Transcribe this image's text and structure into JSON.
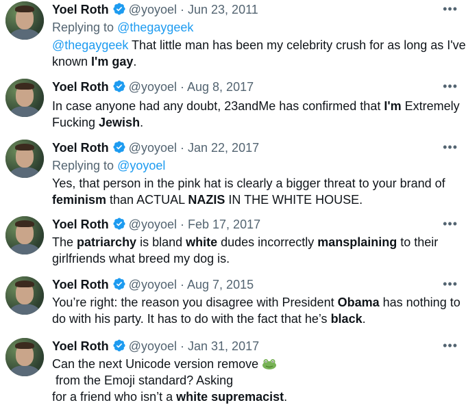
{
  "tweets": [
    {
      "author": "Yoel Roth",
      "handle": "@yoyoel",
      "date": "Jun 23, 2011",
      "reply_prefix": "Replying to",
      "reply_to": "@thegaygeek",
      "lines": [
        [
          {
            "t": "@thegaygeek",
            "s": "mention"
          },
          {
            "t": " That little man has been my celebrity crush for as long as I've",
            "s": ""
          }
        ],
        [
          {
            "t": "known ",
            "s": ""
          },
          {
            "t": "I'm gay",
            "s": "bold"
          },
          {
            "t": ".",
            "s": ""
          }
        ]
      ]
    },
    {
      "author": "Yoel Roth",
      "handle": "@yoyoel",
      "date": "Aug 8, 2017",
      "lines": [
        [
          {
            "t": "In case anyone had any doubt, 23andMe has confirmed that ",
            "s": ""
          },
          {
            "t": "I'm",
            "s": "bold"
          },
          {
            "t": " Extremely",
            "s": ""
          }
        ],
        [
          {
            "t": "Fucking ",
            "s": ""
          },
          {
            "t": "Jewish",
            "s": "bold"
          },
          {
            "t": ".",
            "s": ""
          }
        ]
      ]
    },
    {
      "author": "Yoel Roth",
      "handle": "@yoyoel",
      "date": "Jan 22, 2017",
      "reply_prefix": "Replying to",
      "reply_to": "@yoyoel",
      "lines": [
        [
          {
            "t": "Yes, that person in the pink hat is clearly a bigger threat to your brand of",
            "s": ""
          }
        ],
        [
          {
            "t": "feminism",
            "s": "bold"
          },
          {
            "t": " than ACTUAL ",
            "s": ""
          },
          {
            "t": "NAZIS",
            "s": "bold"
          },
          {
            "t": " IN THE WHITE HOUSE.",
            "s": ""
          }
        ]
      ]
    },
    {
      "author": "Yoel Roth",
      "handle": "@yoyoel",
      "date": "Feb 17, 2017",
      "lines": [
        [
          {
            "t": "The ",
            "s": ""
          },
          {
            "t": "patriarchy",
            "s": "bold"
          },
          {
            "t": " is bland ",
            "s": ""
          },
          {
            "t": "white",
            "s": "bold"
          },
          {
            "t": " dudes incorrectly ",
            "s": ""
          },
          {
            "t": "mansplaining",
            "s": "bold"
          },
          {
            "t": " to their",
            "s": ""
          }
        ],
        [
          {
            "t": "girlfriends what breed my dog is.",
            "s": ""
          }
        ]
      ]
    },
    {
      "author": "Yoel Roth",
      "handle": "@yoyoel",
      "date": "Aug 7, 2015",
      "lines": [
        [
          {
            "t": "You’re right: the reason you disagree with President ",
            "s": ""
          },
          {
            "t": "Obama",
            "s": "bold"
          },
          {
            "t": " has nothing to",
            "s": ""
          }
        ],
        [
          {
            "t": "do with his party. It has to do with the fact that he’s ",
            "s": ""
          },
          {
            "t": "black",
            "s": "bold"
          },
          {
            "t": ".",
            "s": ""
          }
        ]
      ]
    },
    {
      "author": "Yoel Roth",
      "handle": "@yoyoel",
      "date": "Jan 31, 2017",
      "lines": [
        [
          {
            "t": "Can the next Unicode version remove ",
            "s": ""
          },
          {
            "t": "frog-emoji",
            "s": "emoji"
          },
          {
            "t": " from the Emoji standard? Asking",
            "s": ""
          }
        ],
        [
          {
            "t": "for a friend who isn’t a ",
            "s": ""
          },
          {
            "t": "white supremacist",
            "s": "bold"
          },
          {
            "t": ".",
            "s": ""
          }
        ]
      ]
    }
  ],
  "colors": {
    "link": "#1d9bf0",
    "muted": "#536471",
    "text": "#0f1419",
    "verified": "#1d9bf0"
  },
  "separator": "·",
  "more_glyph": "•••"
}
